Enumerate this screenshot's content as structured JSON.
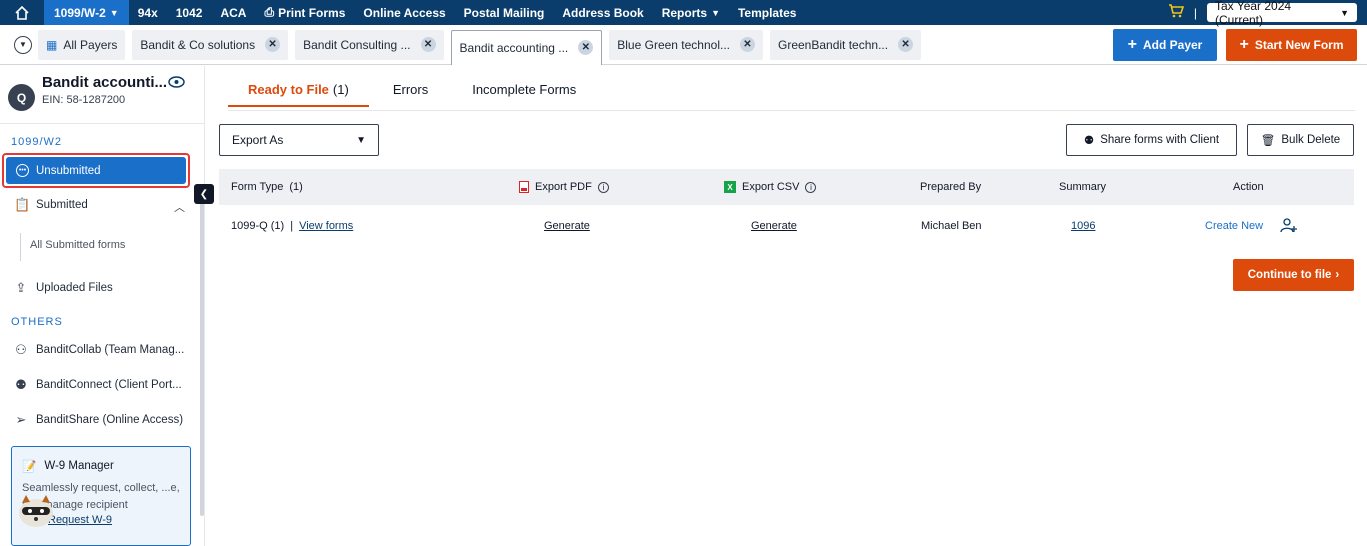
{
  "topnav": {
    "home_icon": "home-icon",
    "items": [
      {
        "label": "1099/W-2",
        "active": true,
        "dropdown": true
      },
      {
        "label": "94x"
      },
      {
        "label": "1042"
      },
      {
        "label": "ACA"
      },
      {
        "label": "Print Forms",
        "icon": "printer-icon"
      },
      {
        "label": "Online Access"
      },
      {
        "label": "Postal Mailing"
      },
      {
        "label": "Address Book"
      },
      {
        "label": "Reports",
        "dropdown": true
      },
      {
        "label": "Templates"
      }
    ],
    "cart_icon": "cart-icon",
    "separator": "|",
    "tax_year": "Tax Year 2024 (Current)"
  },
  "tabsbar": {
    "all_payers": "All Payers",
    "tabs": [
      {
        "label": "Bandit & Co solutions"
      },
      {
        "label": "Bandit Consulting ..."
      },
      {
        "label": "Bandit accounting ...",
        "active": true
      },
      {
        "label": "Blue Green technol..."
      },
      {
        "label": "GreenBandit techn..."
      }
    ],
    "add_payer": "Add Payer",
    "start_new_form": "Start New Form"
  },
  "sidebar": {
    "avatar_letter": "Q",
    "payer_name": "Bandit accounti...",
    "ein": "EIN: 58-1287200",
    "section_1099": "1099/W2",
    "unsubmitted": "Unsubmitted",
    "submitted": "Submitted",
    "all_submitted": "All Submitted forms",
    "uploaded_files": "Uploaded Files",
    "section_others": "OTHERS",
    "bandit_collab": "BanditCollab (Team Manag...",
    "bandit_connect": "BanditConnect (Client Port...",
    "bandit_share": "BanditShare (Online Access)",
    "w9": {
      "title": "W-9 Manager",
      "desc": "Seamlessly request, collect, ...e, and manage recipient",
      "link": "Request W-9"
    }
  },
  "main": {
    "tabs": [
      {
        "label": "Ready to File",
        "count": "(1)",
        "active": true
      },
      {
        "label": "Errors"
      },
      {
        "label": "Incomplete Forms"
      }
    ],
    "export_as": "Export As",
    "share_forms": "Share forms with Client",
    "bulk_delete": "Bulk Delete",
    "table": {
      "headers": {
        "form_type": "Form Type",
        "form_type_count": "(1)",
        "export_pdf": "Export PDF",
        "export_csv": "Export CSV",
        "prepared_by": "Prepared By",
        "summary": "Summary",
        "action": "Action"
      },
      "rows": [
        {
          "form_type": "1099-Q (1)",
          "separator": "|",
          "view_forms": "View forms",
          "pdf": "Generate",
          "csv": "Generate",
          "prepared_by": "Michael Ben",
          "summary": "1096",
          "action": "Create New"
        }
      ]
    },
    "continue": "Continue to file"
  }
}
